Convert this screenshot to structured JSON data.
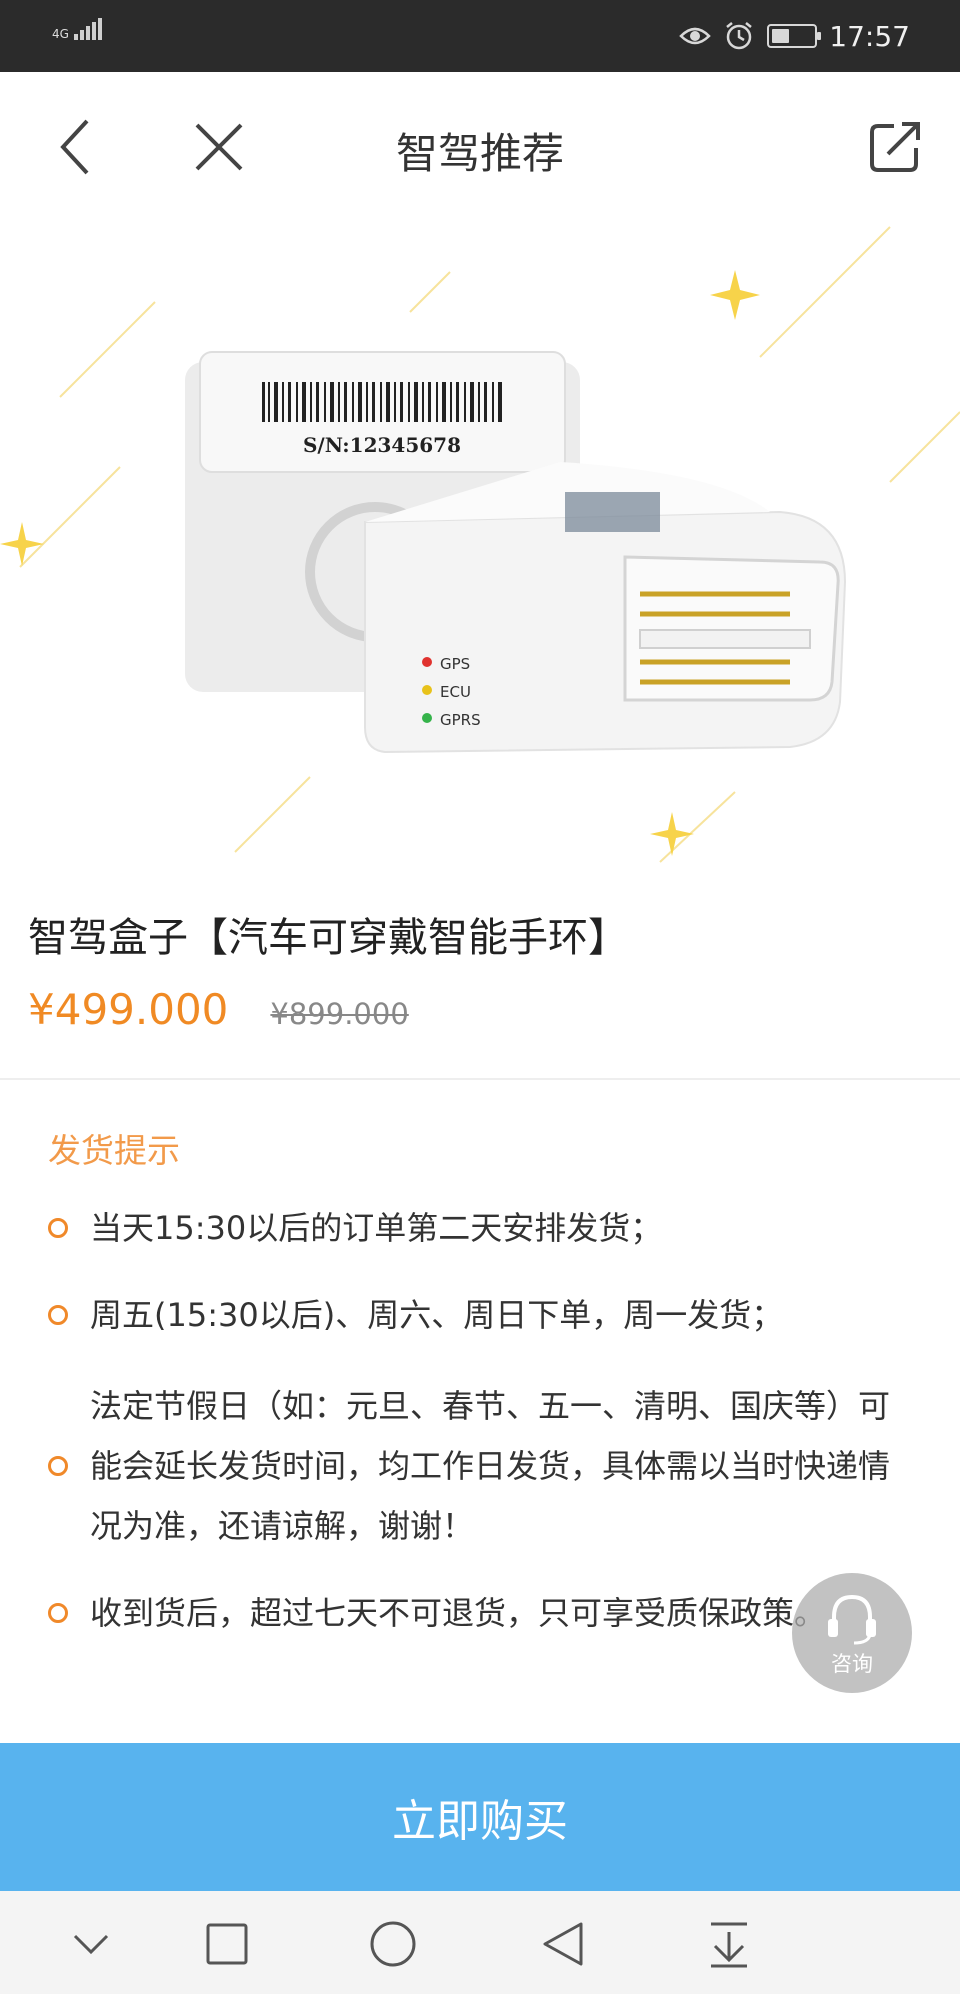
{
  "status_bar": {
    "network": "4G",
    "time": "17:57",
    "battery_level": 0.4
  },
  "nav": {
    "title": "智驾推荐",
    "back_icon": "chevron-left-icon",
    "close_icon": "close-icon",
    "share_icon": "external-share-icon"
  },
  "hero": {
    "serial_text": "S/N:12345678",
    "led_labels": [
      "GPS",
      "ECU",
      "GPRS"
    ],
    "led_colors": [
      "#e0322e",
      "#e8c21a",
      "#35b34a"
    ]
  },
  "product": {
    "title": "智驾盒子【汽车可穿戴智能手环】",
    "price": "¥499.000",
    "original_price": "¥899.000"
  },
  "shipping": {
    "title": "发货提示",
    "tips": [
      "当天15:30以后的订单第二天安排发货；",
      "周五(15:30以后)、周六、周日下单，周一发货；",
      "法定节假日（如：元旦、春节、五一、清明、国庆等）可能会延长发货时间，均工作日发货，具体需以当时快递情况为准，还请谅解，谢谢！",
      "收到货后，超过七天不可退货，只可享受质保政策。"
    ]
  },
  "consult": {
    "label": "咨询",
    "icon": "headset-icon"
  },
  "buy_button": {
    "label": "立即购买",
    "color": "#58b3ee"
  },
  "accent_color": "#f08a24",
  "system_nav": {
    "icons": [
      "chevron-down-icon",
      "square-icon",
      "circle-icon",
      "triangle-back-icon",
      "download-icon"
    ]
  }
}
